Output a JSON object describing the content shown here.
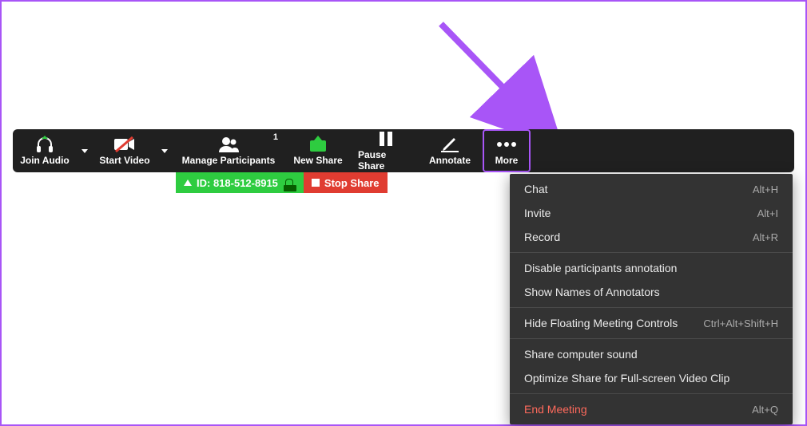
{
  "toolbar": {
    "join_audio": "Join Audio",
    "start_video": "Start Video",
    "manage_participants": "Manage Participants",
    "participants_count": "1",
    "new_share": "New Share",
    "pause_share": "Pause Share",
    "annotate": "Annotate",
    "more": "More"
  },
  "idbar": {
    "meeting_id": "ID: 818-512-8915",
    "stop_share": "Stop Share"
  },
  "menu": {
    "chat": {
      "label": "Chat",
      "shortcut": "Alt+H"
    },
    "invite": {
      "label": "Invite",
      "shortcut": "Alt+I"
    },
    "record": {
      "label": "Record",
      "shortcut": "Alt+R"
    },
    "disable_anno": {
      "label": "Disable participants annotation"
    },
    "show_names": {
      "label": "Show Names of Annotators"
    },
    "hide_controls": {
      "label": "Hide Floating Meeting Controls",
      "shortcut": "Ctrl+Alt+Shift+H"
    },
    "share_sound": {
      "label": "Share computer sound"
    },
    "optimize": {
      "label": "Optimize Share for Full-screen Video Clip"
    },
    "end": {
      "label": "End Meeting",
      "shortcut": "Alt+Q"
    }
  }
}
